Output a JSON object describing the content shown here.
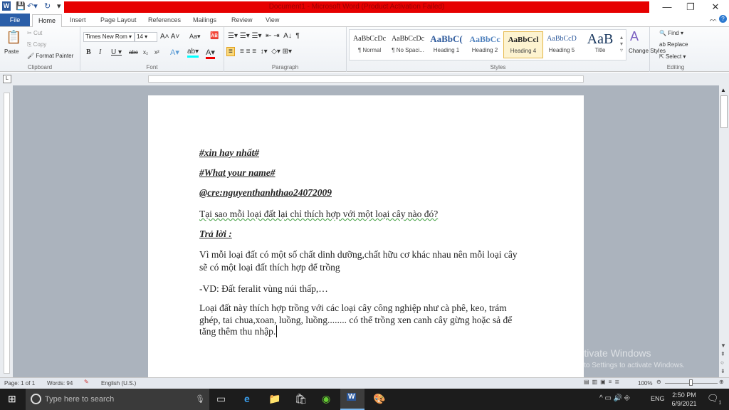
{
  "window": {
    "title": "Document1 - Microsoft Word (Product Activation Failed)"
  },
  "tabs": [
    "File",
    "Home",
    "Insert",
    "Page Layout",
    "References",
    "Mailings",
    "Review",
    "View"
  ],
  "clipboard": {
    "paste": "Paste",
    "cut": "Cut",
    "copy": "Copy",
    "format_painter": "Format Painter",
    "label": "Clipboard"
  },
  "font": {
    "name": "Times New Rom",
    "size": "14",
    "label": "Font"
  },
  "paragraph": {
    "label": "Paragraph"
  },
  "styles": {
    "items": [
      {
        "sample": "AaBbCcDc",
        "name": "¶ Normal"
      },
      {
        "sample": "AaBbCcDc",
        "name": "¶ No Spaci..."
      },
      {
        "sample": "AaBbC(",
        "name": "Heading 1"
      },
      {
        "sample": "AaBbCc",
        "name": "Heading 2"
      },
      {
        "sample": "AaBbCcl",
        "name": "Heading 4"
      },
      {
        "sample": "AaBbCcD",
        "name": "Heading 5"
      },
      {
        "sample": "AaB",
        "name": "Title"
      }
    ],
    "change": "Change Styles",
    "label": "Styles"
  },
  "editing": {
    "find": "Find",
    "replace": "Replace",
    "select": "Select",
    "label": "Editing"
  },
  "document": {
    "lines": [
      "#xin hay nhất#",
      "#What your name#",
      "@cre:nguyenthanhthao24072009",
      "Tại sao mỗi loại đất lại chỉ thích hợp với một loại cây nào đó?",
      "Trả lời :",
      "Vì mỗi loại đất có một số chất dinh dưỡng,chất hữu cơ khác nhau nên mỗi loại cây",
      "sẽ có  một loại đất thích hợp để trồng",
      "-VD: Đất feralit vùng núi thấp,…",
      "Loại đất này thích hợp trồng với các loại cây công nghiệp như cà phê, keo, trám",
      "ghép, tai chua,xoan, luồng, luồng........ có thể trồng xen canh cây gừng hoặc sả để",
      "tăng thêm thu nhập."
    ]
  },
  "status": {
    "page": "Page: 1 of 1",
    "words": "Words: 94",
    "language": "English (U.S.)",
    "zoom": "100%",
    "zoom_slider_percent": 50
  },
  "watermark": {
    "line1": "Activate Windows",
    "line2": "Go to Settings to activate Windows."
  },
  "taskbar": {
    "search_placeholder": "Type here to search",
    "lang": "ENG",
    "time": "2:50 PM",
    "date": "6/9/2021",
    "notifications": "1"
  }
}
